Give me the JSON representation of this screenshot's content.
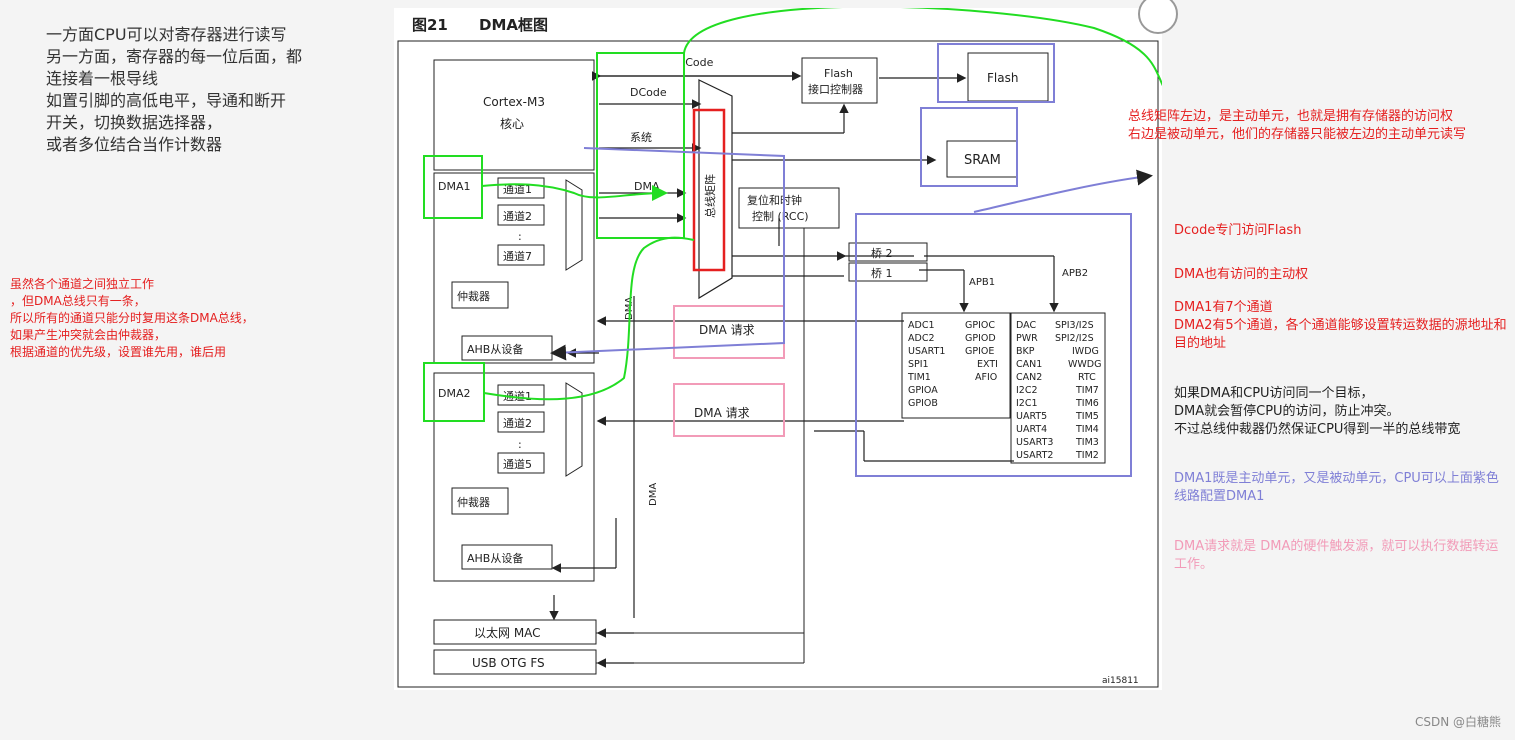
{
  "left_notes": {
    "black": "一方面CPU可以对寄存器进行读写\n另一方面，寄存器的每一位后面，都\n连接着一根导线\n如置引脚的高低电平，导通和断开\n开关，切换数据选择器，\n或者多位结合当作计数器",
    "red": "虽然各个通道之间独立工作\n，但DMA总线只有一条，\n所以所有的通道只能分时复用这条DMA总线，\n如果产生冲突就会由仲裁器，\n根据通道的优先级，设置谁先用，谁后用"
  },
  "right_notes": {
    "bus_matrix": "总线矩阵左边，是主动单元，也就是拥有存储器的访问权\n右边是被动单元，他们的存储器只能被左边的主动单元读写",
    "dcode": "Dcode专门访问Flash",
    "dma_master": "DMA也有访问的主动权",
    "channels": "DMA1有7个通道\nDMA2有5个通道，各个通道能够设置转运数据的源地址和目的地址",
    "conflict": "如果DMA和CPU访问同一个目标，\nDMA就会暂停CPU的访问，防止冲突。\n不过总线仲裁器仍然保证CPU得到一半的总线带宽",
    "dma1_dual": "DMA1既是主动单元，又是被动单元，CPU可以上面紫色线路配置DMA1",
    "dma_request": "DMA请求就是 DMA的硬件触发源，就可以执行数据转运工作。"
  },
  "diagram": {
    "fig_number": "图21",
    "title": "DMA框图",
    "cortex_line1": "Cortex-M3",
    "cortex_line2": "核心",
    "icode": "ICode",
    "dcode": "DCode",
    "system": "系统",
    "dma_bus_label": "DMA",
    "flash_ctrl_line1": "Flash",
    "flash_ctrl_line2": "接口控制器",
    "flash": "Flash",
    "sram": "SRAM",
    "bus_matrix": "总线矩阵",
    "rcc_line1": "复位和时钟",
    "rcc_line2": "控制 (RCC)",
    "bridge2": "桥 2",
    "bridge1": "桥 1",
    "apb1": "APB1",
    "apb2": "APB2",
    "dma1": "DMA1",
    "dma2": "DMA2",
    "ch1": "通道1",
    "ch2": "通道2",
    "ch7": "通道7",
    "ch5": "通道5",
    "arbiter": "仲裁器",
    "ahb_slave": "AHB从设备",
    "dma_request": "DMA 请求",
    "dma_vertical": "DMA",
    "apb2_col1": [
      "ADC1",
      "ADC2",
      "USART1",
      "SPI1",
      "TIM1",
      "GPIOA",
      "GPIOB"
    ],
    "apb2_col2": [
      "GPIOC",
      "GPIOD",
      "GPIOE",
      "EXTI",
      "AFIO"
    ],
    "apb1_col1": [
      "DAC",
      "PWR",
      "BKP",
      "CAN1",
      "CAN2",
      "I2C2",
      "I2C1",
      "UART5",
      "UART4",
      "USART3",
      "USART2"
    ],
    "apb1_col2": [
      "SPI3/I2S",
      "SPI2/I2S",
      "IWDG",
      "WWDG",
      "RTC",
      "TIM7",
      "TIM6",
      "TIM5",
      "TIM4",
      "TIM3",
      "TIM2"
    ],
    "ethernet": "以太网 MAC",
    "usb": "USB OTG FS",
    "fig_code": "ai15811"
  },
  "watermark": "CSDN @白糖熊",
  "colors": {
    "annotation_green": "#22dd22",
    "annotation_red": "#e52020",
    "annotation_purple": "#7f7fd6",
    "annotation_pink": "#f29bb8"
  }
}
